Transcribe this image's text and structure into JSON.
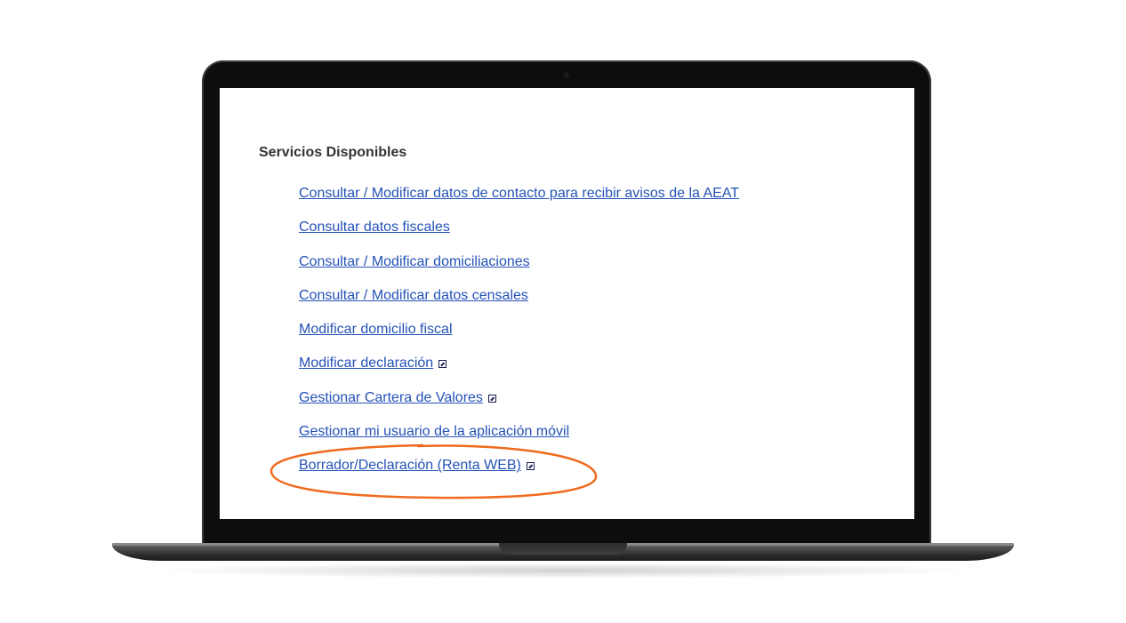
{
  "page": {
    "section_title": "Servicios Disponibles",
    "services": [
      {
        "label": "Consultar / Modificar datos de contacto para recibir avisos de la AEAT",
        "external": false
      },
      {
        "label": "Consultar datos fiscales",
        "external": false
      },
      {
        "label": "Consultar / Modificar domiciliaciones",
        "external": false
      },
      {
        "label": "Consultar / Modificar datos censales",
        "external": false
      },
      {
        "label": "Modificar domicilio fiscal",
        "external": false
      },
      {
        "label": "Modificar declaración",
        "external": true
      },
      {
        "label": "Gestionar Cartera de Valores",
        "external": true
      },
      {
        "label": "Gestionar mi usuario de la aplicación móvil",
        "external": false
      },
      {
        "label": "Borrador/Declaración (Renta WEB)",
        "external": true,
        "highlighted": true
      }
    ]
  },
  "colors": {
    "link": "#2452b8",
    "title": "#333333",
    "highlight_annotation": "#f06a1e",
    "laptop_bezel": "#0d0d0d"
  },
  "icons": {
    "external_link": "external-link-icon"
  }
}
